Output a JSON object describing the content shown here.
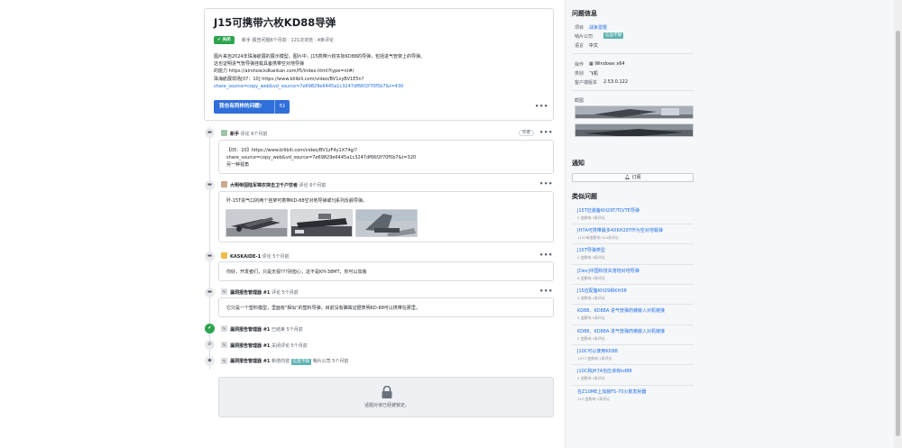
{
  "issue": {
    "title": "J15可携带六枚KD88导弹",
    "status": "关闭",
    "meta": "新手 报告问题6个月前 · 121次浏览 · 4条评论",
    "body": [
      "图片来自2024年珠海航展的展示模型。图片中，J15携带六枚实际KD88的导弹，包括进气管架上的导弹。",
      "这也证明进气管导弹挂载具备携带空对地导弹",
      "的能力 https://airshow.kdkankan.com/f5/index.html?type=nt#/",
      "珠海航展现场[07：10] https://www.bilibili.com/video/BV1xyBV1E5n?",
      "share_source=copy_web&vd_source=7e69829e6445a1c3247df66f2f70f5b7&t=430"
    ],
    "same_button": "我也有同样的问题!",
    "same_count": "51"
  },
  "comments": [
    {
      "author": "新手",
      "action": "评论 6个月前",
      "tag": "作者",
      "lines": [
        "【05：20】https://www.bilibili.com/video/BV1zF4y1X74g/?",
        "share_source=copy_web&vd_source=7e69829e6445a1c3247df66f2f70f5b7&t=320",
        "另一种视角"
      ]
    },
    {
      "author": "大明帝国陆军锦衣突击卫千户饮者",
      "action": "评论 6个月前",
      "lines": [
        "歼-15T进气口的两个挂架可携带KD-88空对地导弹或YJ系列反舰导弹。"
      ]
    },
    {
      "author": "KASKAIDE-1",
      "action": "评论 5个月前",
      "lines": [
        "你好，开发者们，只是无视???别担心，这不是KH-38MT，你可以加装"
      ]
    },
    {
      "author": "漏洞报告管理器 #1",
      "action": "评论 5个月前",
      "lines": [
        "它只是一个塑料模型，里面有\"相似\"的塑料导弹，目前没有确凿证据表明KD-88可以携带在那里。"
      ]
    }
  ],
  "events": [
    {
      "author": "漏洞报告管理器 #1",
      "action": "已结束 5个月前"
    },
    {
      "author": "漏洞报告管理器 #1",
      "action": "关闭评论 5个月前"
    },
    {
      "author": "漏洞报告管理器 #1",
      "action_pre": "新增内容",
      "label": "信息不够",
      "action_post": "哨片公司 5个月前"
    }
  ],
  "lock_text": "话题对该已经被锁定。",
  "sidebar": {
    "info_title": "问题信息",
    "project_key": "项目",
    "project_val": "战争雷霆",
    "company_key": "哨片公司",
    "company_val": "信息不够",
    "lang_key": "语言",
    "lang_val": "中文",
    "platform_key": "操作",
    "platform_val": "Windows x64",
    "category_key": "类别",
    "category_val": "飞机",
    "client_key": "客户端版本",
    "client_val": "2.53.0.122",
    "shots_title": "截图",
    "notify_title": "通知",
    "subscribe": "订阅",
    "similar_title": "类似问题",
    "similar": [
      {
        "t": "J15T应装备KH29T/TD/TE导弹",
        "m": "5 变影响   3条评论"
      },
      {
        "t": "JH7A可携带最多4XKH29T作为空对地载弹",
        "m": "1152有变影响   324条评论"
      },
      {
        "t": "J15T导弹类型",
        "m": "4 变影响   3条评论"
      },
      {
        "t": "[Dev]中国科技失落地对地导弹",
        "m": "6 变影响   3条评论"
      },
      {
        "t": "J15应配备KH29和KH38",
        "m": "4 变影响   4条评论"
      },
      {
        "t": "KD88、KD88A 进气管弹药被嵌入对机链接",
        "m": "4 变影响   5条评论"
      },
      {
        "t": "KD88、KD88A 进气管弹药被嵌入对机链接",
        "m": "2 变影响   3条评论"
      },
      {
        "t": "J10C可以使用KD88",
        "m": "107人变影响   2条评论"
      },
      {
        "t": "J10C和JH7A也应该有kd88",
        "m": "5 变影响   3条评论"
      },
      {
        "t": "在Z10ME上加装FS-70火箭发射器",
        "m": "15人变影响   1条评论"
      }
    ]
  },
  "colors": {
    "accent": "#2f6fd9",
    "closed": "#2da44e",
    "label": "#5fb3b3"
  }
}
